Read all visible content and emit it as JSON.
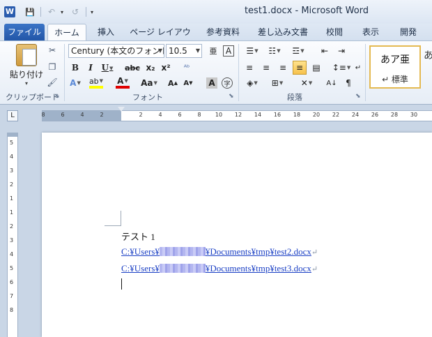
{
  "window": {
    "app_icon_letter": "W",
    "title": "test1.docx - Microsoft Word"
  },
  "qat": {
    "save_icon": "💾",
    "undo_icon": "↶",
    "undo_dd": "▾",
    "redo_icon": "↺",
    "customize_icon": "▾"
  },
  "tabs": [
    {
      "label": "ファイル",
      "state": "file"
    },
    {
      "label": "ホーム",
      "state": "active"
    },
    {
      "label": "挿入"
    },
    {
      "label": "ページ レイアウト"
    },
    {
      "label": "参考資料"
    },
    {
      "label": "差し込み文書"
    },
    {
      "label": "校閲"
    },
    {
      "label": "表示"
    },
    {
      "label": "開発"
    }
  ],
  "ribbon": {
    "clipboard": {
      "paste_label": "貼り付け",
      "paste_dd": "▾",
      "group_label": "クリップボード",
      "launcher": "⬊"
    },
    "font": {
      "font_name": "Century (本文のフォント",
      "font_size": "10.5",
      "bold": "B",
      "italic": "I",
      "underline": "U",
      "strike": "abc",
      "subscript": "x₂",
      "superscript": "x²",
      "grow": "A▲",
      "shrink": "A▼",
      "change_case": "Aa",
      "clear": "A",
      "phonetic": "亜",
      "enclose": "A",
      "enclosed_char": "字",
      "group_label": "フォント",
      "launcher": "⬊"
    },
    "paragraph": {
      "group_label": "段落",
      "launcher": "⬊"
    },
    "styles": {
      "sample": "あア亜",
      "name": "↵ 標準",
      "next_sample": "あ"
    }
  },
  "ruler": {
    "tab_selector": "L",
    "numbers": [
      "8",
      "6",
      "4",
      "2",
      "2",
      "4",
      "6",
      "8",
      "10",
      "12",
      "14",
      "16",
      "18",
      "20",
      "22",
      "24",
      "26",
      "28",
      "30"
    ],
    "vnumbers": [
      "5",
      "4",
      "3",
      "2",
      "1",
      "1",
      "2",
      "3",
      "4",
      "5",
      "6",
      "7",
      "8"
    ]
  },
  "document": {
    "line1": "テスト 1",
    "line2_prefix": "C:¥Users¥",
    "line2_suffix": "¥Documents¥tmp¥test2.docx",
    "line3_prefix": "C:¥Users¥",
    "line3_suffix": "¥Documents¥tmp¥test3.docx",
    "para_mark": "↵"
  }
}
